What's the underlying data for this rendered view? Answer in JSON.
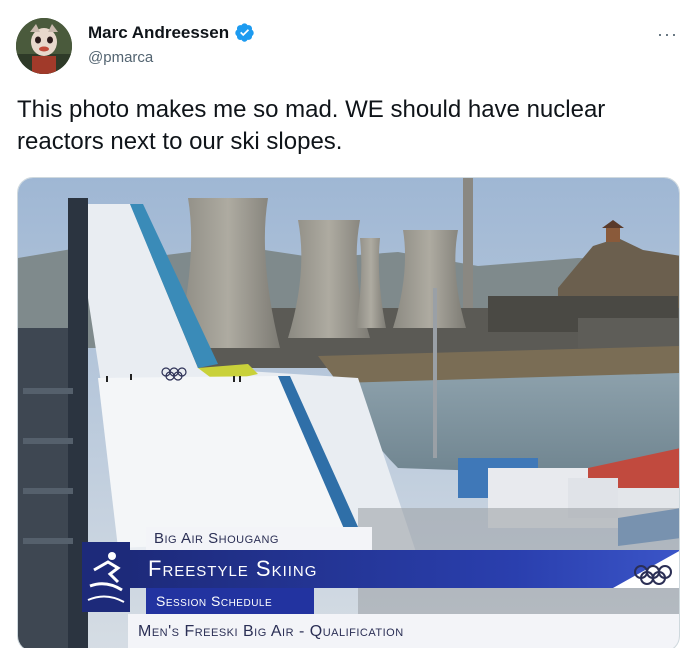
{
  "author": {
    "name": "Marc Andreessen",
    "handle": "@pmarca",
    "verified": true,
    "avatar_icon": "avatar-icon"
  },
  "more_label": "···",
  "tweet": {
    "text": "This photo makes me so mad. WE should have nuclear reactors next to our ski slopes."
  },
  "media": {
    "broadcast": {
      "venue": "Big Air Shougang",
      "sport": "Freestyle Skiing",
      "session": "Session Schedule",
      "event": "Men's Freeski Big Air - Qualification"
    }
  },
  "colors": {
    "verified": "#1d9bf0",
    "broadcast_blue": "#1d2a7a",
    "text": "#0f1419",
    "secondary": "#536471"
  }
}
